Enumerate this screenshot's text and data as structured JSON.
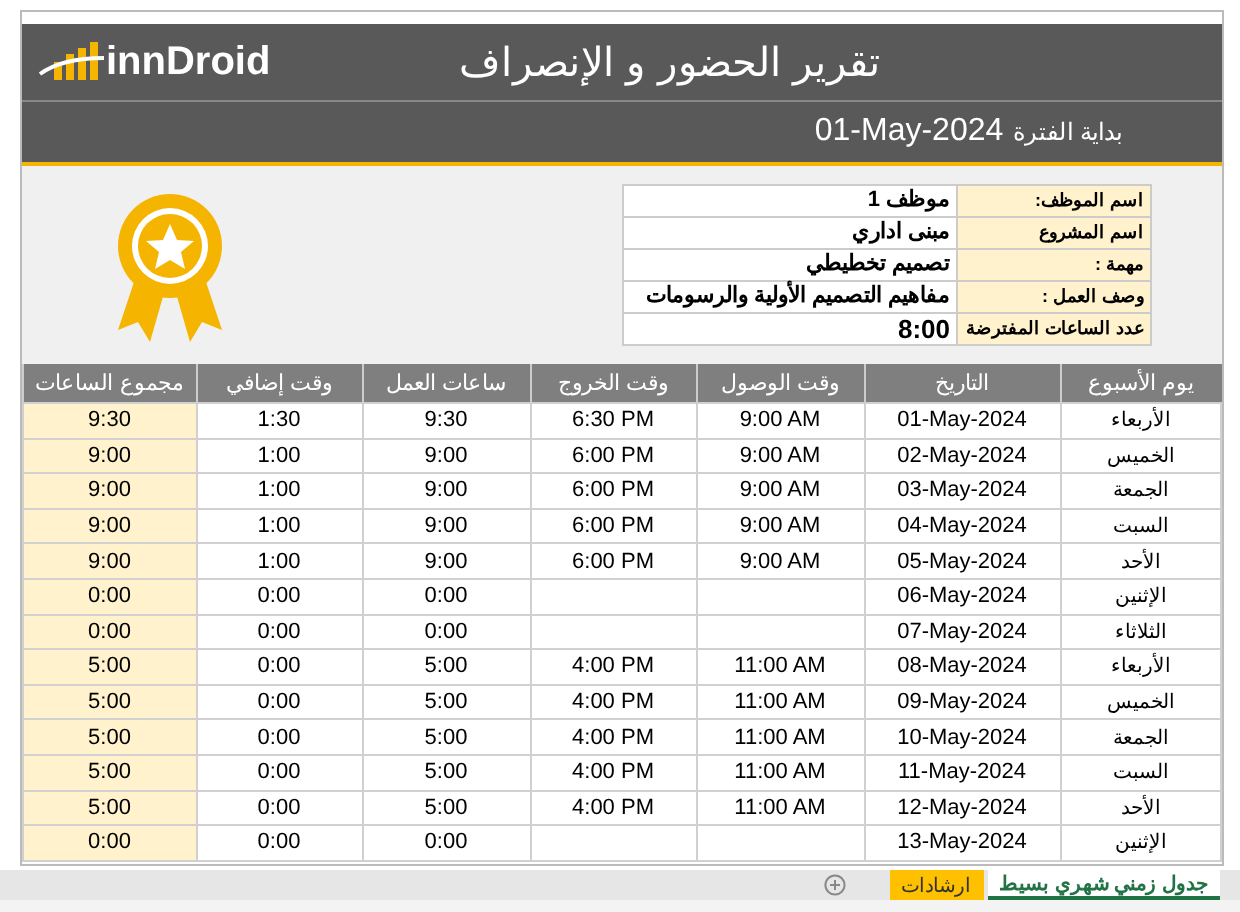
{
  "header": {
    "logo": "innDroid",
    "title": "تقرير الحضور و الإنصراف",
    "period_label": "بداية الفترة",
    "period_value": "01-May-2024"
  },
  "info": [
    {
      "label": "اسم الموظف:",
      "value": "موظف 1"
    },
    {
      "label": "اسم المشروع",
      "value": "مبنى اداري"
    },
    {
      "label": "مهمة :",
      "value": "تصميم تخطيطي"
    },
    {
      "label": "وصف العمل :",
      "value": "مفاهيم التصميم الأولية والرسومات"
    },
    {
      "label": "عدد الساعات المفترضة",
      "value": "8:00"
    }
  ],
  "table": {
    "columns": [
      {
        "label": "يوم الأسبوع",
        "highlighted": false
      },
      {
        "label": "التاريخ",
        "highlighted": false
      },
      {
        "label": "وقت الوصول",
        "highlighted": false
      },
      {
        "label": "وقت الخروج",
        "highlighted": false
      },
      {
        "label": "ساعات العمل",
        "highlighted": false
      },
      {
        "label": "وقت إضافي",
        "highlighted": false
      },
      {
        "label": "مجموع الساعات",
        "highlighted": true
      }
    ],
    "rows": [
      [
        "الأربعاء",
        "01-May-2024",
        "9:00 AM",
        "6:30 PM",
        "9:30",
        "1:30",
        "9:30"
      ],
      [
        "الخميس",
        "02-May-2024",
        "9:00 AM",
        "6:00 PM",
        "9:00",
        "1:00",
        "9:00"
      ],
      [
        "الجمعة",
        "03-May-2024",
        "9:00 AM",
        "6:00 PM",
        "9:00",
        "1:00",
        "9:00"
      ],
      [
        "السبت",
        "04-May-2024",
        "9:00 AM",
        "6:00 PM",
        "9:00",
        "1:00",
        "9:00"
      ],
      [
        "الأحد",
        "05-May-2024",
        "9:00 AM",
        "6:00 PM",
        "9:00",
        "1:00",
        "9:00"
      ],
      [
        "الإثنين",
        "06-May-2024",
        null,
        null,
        "0:00",
        "0:00",
        "0:00"
      ],
      [
        "الثلاثاء",
        "07-May-2024",
        null,
        null,
        "0:00",
        "0:00",
        "0:00"
      ],
      [
        "الأربعاء",
        "08-May-2024",
        "11:00 AM",
        "4:00 PM",
        "5:00",
        "0:00",
        "5:00"
      ],
      [
        "الخميس",
        "09-May-2024",
        "11:00 AM",
        "4:00 PM",
        "5:00",
        "0:00",
        "5:00"
      ],
      [
        "الجمعة",
        "10-May-2024",
        "11:00 AM",
        "4:00 PM",
        "5:00",
        "0:00",
        "5:00"
      ],
      [
        "السبت",
        "11-May-2024",
        "11:00 AM",
        "4:00 PM",
        "5:00",
        "0:00",
        "5:00"
      ],
      [
        "الأحد",
        "12-May-2024",
        "11:00 AM",
        "4:00 PM",
        "5:00",
        "0:00",
        "5:00"
      ],
      [
        "الإثنين",
        "13-May-2024",
        null,
        null,
        "0:00",
        "0:00",
        "0:00"
      ]
    ]
  },
  "sheet_tabs": [
    {
      "label": "جدول زمني شهري بسيط",
      "selected": true
    },
    {
      "label": "ارشادات",
      "selected": false
    }
  ]
}
